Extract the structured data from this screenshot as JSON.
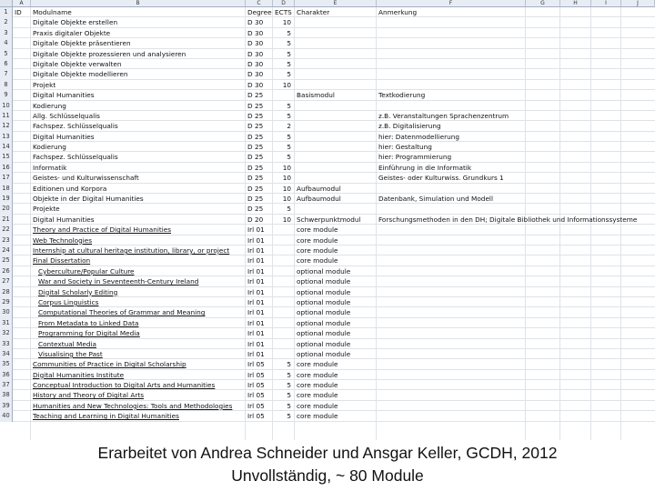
{
  "columns": [
    "A",
    "B",
    "C",
    "D",
    "E",
    "F",
    "G",
    "H",
    "I",
    "J"
  ],
  "rows": [
    {
      "n": "1",
      "a": "ID",
      "b": "Modulname",
      "c": "Degree",
      "d": "ECTS",
      "e": "Charakter",
      "f": "Anmerkung",
      "ub": false
    },
    {
      "n": "2",
      "a": "",
      "b": "Digitale Objekte erstellen",
      "c": "D 30",
      "d": "10",
      "e": "",
      "f": "",
      "ub": false
    },
    {
      "n": "3",
      "a": "",
      "b": "Praxis digitaler Objekte",
      "c": "D 30",
      "d": "5",
      "e": "",
      "f": "",
      "ub": false
    },
    {
      "n": "4",
      "a": "",
      "b": "Digitale Objekte präsentieren",
      "c": "D 30",
      "d": "5",
      "e": "",
      "f": "",
      "ub": false
    },
    {
      "n": "5",
      "a": "",
      "b": "Digitale Objekte prozessieren und analysieren",
      "c": "D 30",
      "d": "5",
      "e": "",
      "f": "",
      "ub": false
    },
    {
      "n": "6",
      "a": "",
      "b": "Digitale Objekte verwalten",
      "c": "D 30",
      "d": "5",
      "e": "",
      "f": "",
      "ub": false
    },
    {
      "n": "7",
      "a": "",
      "b": "Digitale Objekte modellieren",
      "c": "D 30",
      "d": "5",
      "e": "",
      "f": "",
      "ub": false
    },
    {
      "n": "8",
      "a": "",
      "b": "Projekt",
      "c": "D 30",
      "d": "10",
      "e": "",
      "f": "",
      "ub": false
    },
    {
      "n": "9",
      "a": "",
      "b": "Digital Humanities",
      "c": "D 25",
      "d": "",
      "e": "Basismodul",
      "f": "Textkodierung",
      "ub": false
    },
    {
      "n": "10",
      "a": "",
      "b": "Kodierung",
      "c": "D 25",
      "d": "5",
      "e": "",
      "f": "",
      "ub": false
    },
    {
      "n": "11",
      "a": "",
      "b": "Allg. Schlüsselqualis",
      "c": "D 25",
      "d": "5",
      "e": "",
      "f": "z.B. Veranstaltungen Sprachenzentrum",
      "ub": false
    },
    {
      "n": "12",
      "a": "",
      "b": "Fachspez. Schlüsselqualis",
      "c": "D 25",
      "d": "2",
      "e": "",
      "f": "z.B. Digitalisierung",
      "ub": false
    },
    {
      "n": "13",
      "a": "",
      "b": "Digital Humanities",
      "c": "D 25",
      "d": "5",
      "e": "",
      "f": "hier: Datenmodellierung",
      "ub": false
    },
    {
      "n": "14",
      "a": "",
      "b": "Kodierung",
      "c": "D 25",
      "d": "5",
      "e": "",
      "f": "hier: Gestaltung",
      "ub": false
    },
    {
      "n": "15",
      "a": "",
      "b": "Fachspez. Schlüsselqualis",
      "c": "D 25",
      "d": "5",
      "e": "",
      "f": "hier: Programmierung",
      "ub": false
    },
    {
      "n": "16",
      "a": "",
      "b": "Informatik",
      "c": "D 25",
      "d": "10",
      "e": "",
      "f": "Einführung in die Informatik",
      "ub": false
    },
    {
      "n": "17",
      "a": "",
      "b": "Geistes- und Kulturwissenschaft",
      "c": "D 25",
      "d": "10",
      "e": "",
      "f": "Geistes- oder Kulturwiss. Grundkurs 1",
      "ub": false
    },
    {
      "n": "18",
      "a": "",
      "b": "Editionen und Korpora",
      "c": "D 25",
      "d": "10",
      "e": "Aufbaumodul",
      "f": "",
      "ub": false
    },
    {
      "n": "19",
      "a": "",
      "b": "Objekte in der Digital Humanities",
      "c": "D 25",
      "d": "10",
      "e": "Aufbaumodul",
      "f": "Datenbank, Simulation und Modell",
      "ub": false
    },
    {
      "n": "20",
      "a": "",
      "b": "Projekte",
      "c": "D 25",
      "d": "5",
      "e": "",
      "f": "",
      "ub": false
    },
    {
      "n": "21",
      "a": "",
      "b": "Digital Humanities",
      "c": "D 20",
      "d": "10",
      "e": "Schwerpunktmodul",
      "f": "Forschungsmethoden in den DH; Digitale Bibliothek und Informationssysteme",
      "ub": false
    },
    {
      "n": "22",
      "a": "",
      "b": "Theory and Practice of Digital Humanities",
      "c": "Irl 01",
      "d": "",
      "e": "core module",
      "f": "",
      "ub": true
    },
    {
      "n": "23",
      "a": "",
      "b": "Web Technologies",
      "c": "Irl 01",
      "d": "",
      "e": "core module",
      "f": "",
      "ub": true
    },
    {
      "n": "24",
      "a": "",
      "b": "Internship at cultural heritage institution, library, or project",
      "c": "Irl 01",
      "d": "",
      "e": "core module",
      "f": "",
      "ub": true
    },
    {
      "n": "25",
      "a": "",
      "b": "Final Dissertation",
      "c": "Irl 01",
      "d": "",
      "e": "core module",
      "f": "",
      "ub": true
    },
    {
      "n": "26",
      "a": "",
      "b": "Cyberculture/Popular Culture",
      "c": "Irl 01",
      "d": "",
      "e": "optional module",
      "f": "",
      "ub": true,
      "ind": true
    },
    {
      "n": "27",
      "a": "",
      "b": "War and Society in Seventeenth-Century Ireland",
      "c": "Irl 01",
      "d": "",
      "e": "optional module",
      "f": "",
      "ub": true,
      "ind": true
    },
    {
      "n": "28",
      "a": "",
      "b": "Digital Scholarly Editing",
      "c": "Irl 01",
      "d": "",
      "e": "optional module",
      "f": "",
      "ub": true,
      "ind": true
    },
    {
      "n": "29",
      "a": "",
      "b": "Corpus Linguistics",
      "c": "Irl 01",
      "d": "",
      "e": "optional module",
      "f": "",
      "ub": true,
      "ind": true
    },
    {
      "n": "30",
      "a": "",
      "b": "Computational Theories of Grammar and Meaning",
      "c": "Irl 01",
      "d": "",
      "e": "optional module",
      "f": "",
      "ub": true,
      "ind": true
    },
    {
      "n": "31",
      "a": "",
      "b": "From Metadata to Linked Data",
      "c": "Irl 01",
      "d": "",
      "e": "optional module",
      "f": "",
      "ub": true,
      "ind": true
    },
    {
      "n": "32",
      "a": "",
      "b": "Programming for Digital Media",
      "c": "Irl 01",
      "d": "",
      "e": "optional module",
      "f": "",
      "ub": true,
      "ind": true
    },
    {
      "n": "33",
      "a": "",
      "b": "Contextual Media",
      "c": "Irl 01",
      "d": "",
      "e": "optional module",
      "f": "",
      "ub": true,
      "ind": true
    },
    {
      "n": "34",
      "a": "",
      "b": "Visualising the Past",
      "c": "Irl 01",
      "d": "",
      "e": "optional module",
      "f": "",
      "ub": true,
      "ind": true
    },
    {
      "n": "35",
      "a": "",
      "b": "Communities of Practice in Digital Scholarship",
      "c": "Irl 05",
      "d": "5",
      "e": "core module",
      "f": "",
      "ub": true
    },
    {
      "n": "36",
      "a": "",
      "b": "Digital Humanities Institute",
      "c": "Irl 05",
      "d": "5",
      "e": "core module",
      "f": "",
      "ub": true
    },
    {
      "n": "37",
      "a": "",
      "b": "Conceptual Introduction to Digital Arts and Humanities",
      "c": "Irl 05",
      "d": "5",
      "e": "core module",
      "f": "",
      "ub": true
    },
    {
      "n": "38",
      "a": "",
      "b": "History and Theory of Digital Arts",
      "c": "Irl 05",
      "d": "5",
      "e": "core module",
      "f": "",
      "ub": true
    },
    {
      "n": "39",
      "a": "",
      "b": "Humanities and New Technologies: Tools and Methodologies",
      "c": "Irl 05",
      "d": "5",
      "e": "core module",
      "f": "",
      "ub": true
    },
    {
      "n": "40",
      "a": "",
      "b": "Teaching and Learning in Digital Humanities",
      "c": "Irl 05",
      "d": "5",
      "e": "core module",
      "f": "",
      "ub": true
    }
  ],
  "caption": {
    "line1": "Erarbeitet von Andrea Schneider und Ansgar Keller, GCDH, 2012",
    "line2": "Unvollständig,  ~ 80 Module"
  }
}
